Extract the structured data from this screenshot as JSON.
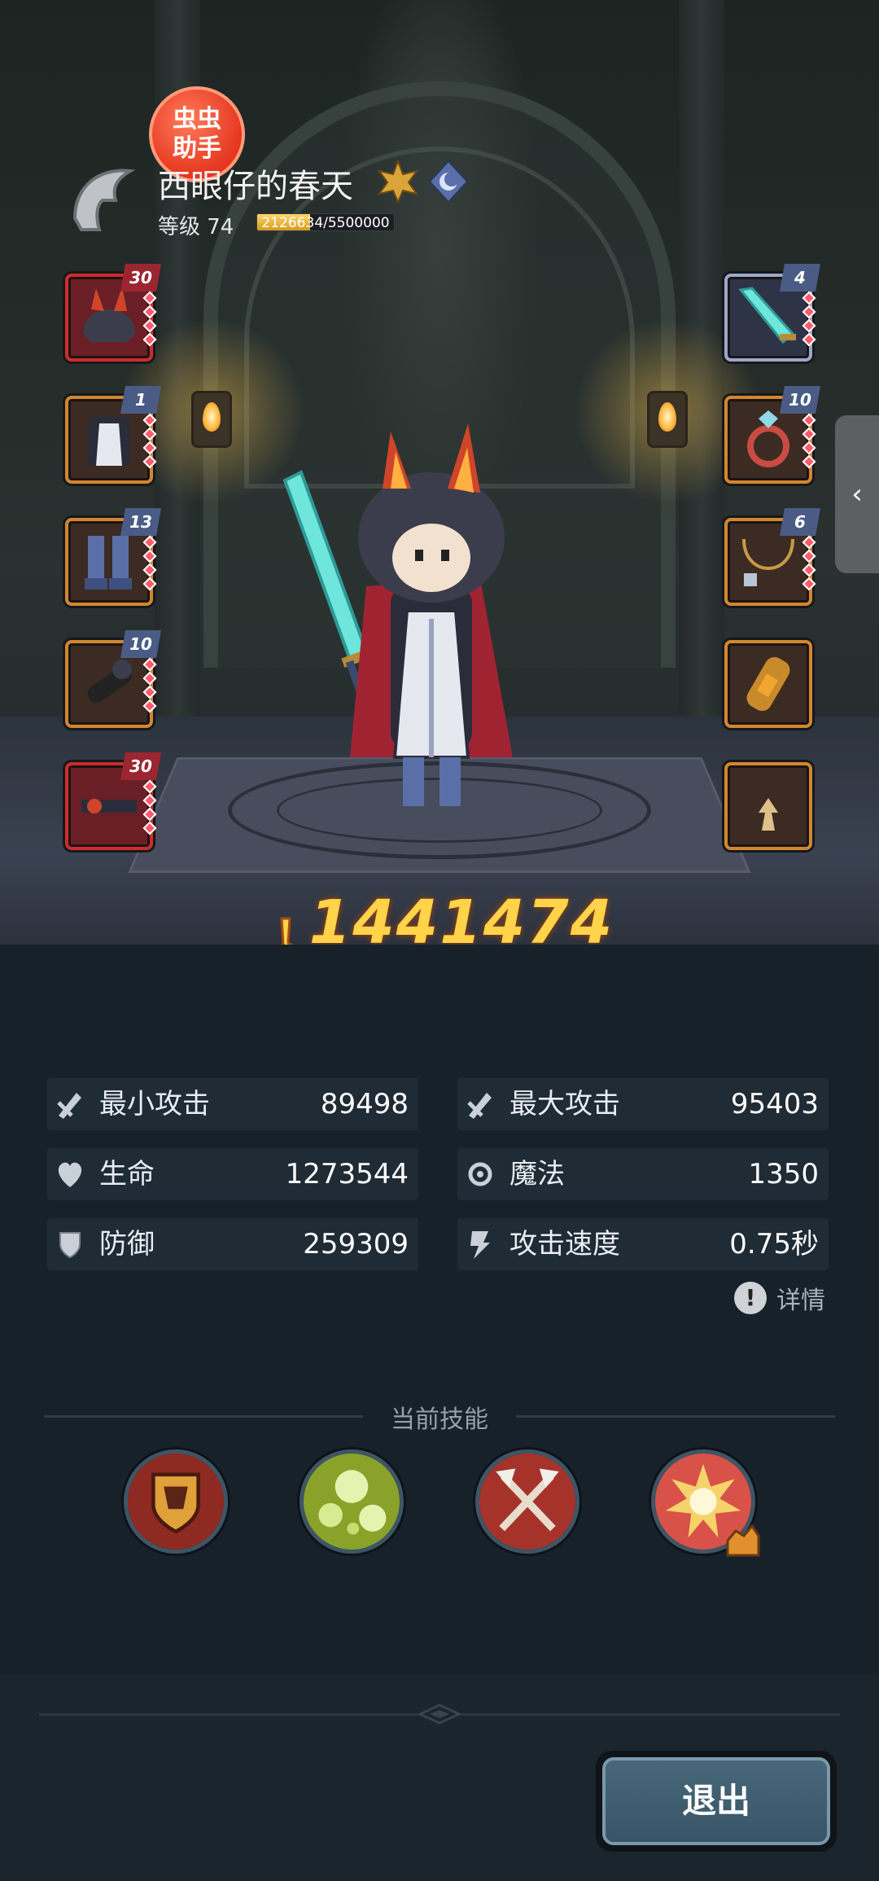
{
  "player": {
    "badge_text": "虫虫\n助手",
    "name": "西眼仔的春天",
    "level_label": "等级 74",
    "exp_text": "2126634/5500000",
    "exp_fraction": 0.387
  },
  "equipment": {
    "left": [
      {
        "name": "helmet",
        "level": "30",
        "rarity": "red"
      },
      {
        "name": "armor",
        "level": "1",
        "rarity": "orange"
      },
      {
        "name": "boots",
        "level": "13",
        "rarity": "orange"
      },
      {
        "name": "gloves",
        "level": "10",
        "rarity": "orange"
      },
      {
        "name": "belt",
        "level": "30",
        "rarity": "red"
      }
    ],
    "right": [
      {
        "name": "sword",
        "level": "4",
        "rarity": "teal"
      },
      {
        "name": "ring",
        "level": "10",
        "rarity": "orange"
      },
      {
        "name": "necklace",
        "level": "6",
        "rarity": "orange"
      },
      {
        "name": "bracer",
        "level": "",
        "rarity": "orange"
      },
      {
        "name": "pendant",
        "level": "",
        "rarity": "orange"
      }
    ]
  },
  "power": "1441474",
  "stats": [
    {
      "label": "最小攻击",
      "value": "89498",
      "icon": "sword-icon"
    },
    {
      "label": "最大攻击",
      "value": "95403",
      "icon": "sword-icon"
    },
    {
      "label": "生命",
      "value": "1273544",
      "icon": "heart-icon"
    },
    {
      "label": "魔法",
      "value": "1350",
      "icon": "magic-icon"
    },
    {
      "label": "防御",
      "value": "259309",
      "icon": "shield-icon"
    },
    {
      "label": "攻击速度",
      "value": "0.75秒",
      "icon": "speed-icon"
    }
  ],
  "detail_label": "详情",
  "skills_title": "当前技能",
  "skills": [
    "shield-crest-skill",
    "poison-bubble-skill",
    "crossed-axes-skill",
    "explosion-skill"
  ],
  "exit_label": "退出",
  "colors": {
    "power": "#ffd34a",
    "accent_red": "#cf2b2b",
    "accent_orange": "#d2862f"
  }
}
